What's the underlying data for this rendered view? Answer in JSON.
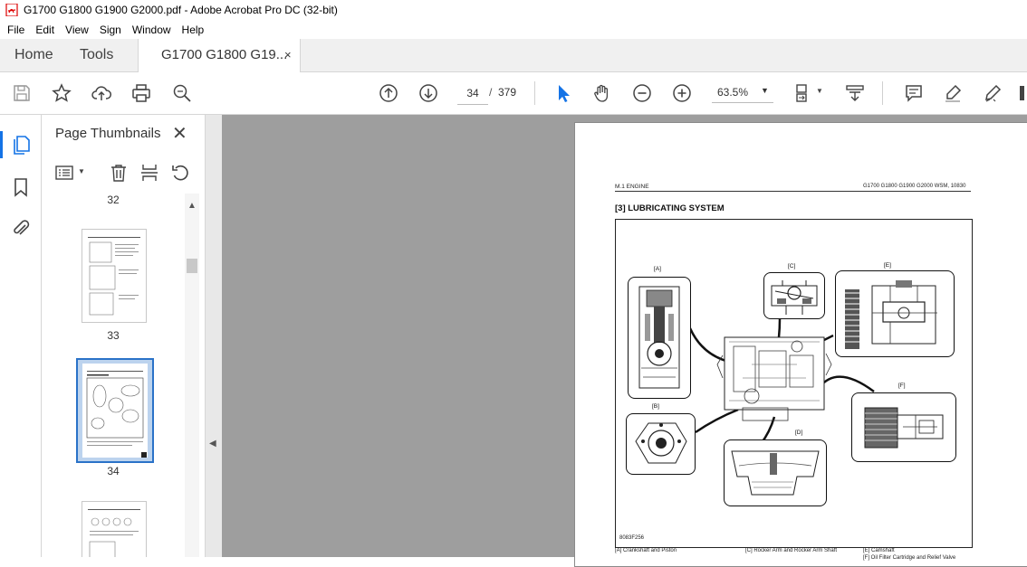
{
  "window": {
    "title": "G1700 G1800 G1900 G2000.pdf - Adobe Acrobat Pro DC (32-bit)"
  },
  "menu": [
    "File",
    "Edit",
    "View",
    "Sign",
    "Window",
    "Help"
  ],
  "tabs": {
    "home": "Home",
    "tools": "Tools",
    "document": "G1700 G1800 G19...",
    "close": "×"
  },
  "toolbar": {
    "page_current": "34",
    "page_separator": "/",
    "page_total": "379",
    "zoom": "63.5%",
    "icons": [
      "save-icon",
      "bookmark-star-icon",
      "upload-cloud-icon",
      "print-icon",
      "zoom-search-icon",
      "page-up-icon",
      "page-down-icon",
      "select-pointer-icon",
      "hand-icon",
      "zoom-out-icon",
      "zoom-in-icon",
      "page-fit-icon",
      "scroll-mode-icon",
      "comment-icon",
      "highlight-pen-icon",
      "sign-pen-icon"
    ]
  },
  "side_panel": {
    "title": "Page Thumbnails",
    "close": "✕",
    "thumbnails": [
      {
        "label": "32"
      },
      {
        "label": "33"
      },
      {
        "label": "34",
        "selected": true
      },
      {
        "label": ""
      }
    ]
  },
  "document_page": {
    "header_left": "M.1 ENGINE",
    "header_right": "G1700 G1800 G1900 G2000   WSM, 10830",
    "section_title": "[3]  LUBRICATING  SYSTEM",
    "figure_code": "8083F256",
    "callouts": [
      "[A]",
      "[B]",
      "[C]",
      "[D]",
      "[E]",
      "[F]"
    ],
    "legend": [
      "[A]   Crankshaft and Piston",
      "[C]   Rocker Arm and Rocker Arm Shaft",
      "[E]   Camshaft",
      "[F]   Oil Filter Cartridge and Relief Valve"
    ]
  },
  "colors": {
    "accent": "#1473e6",
    "doc_bg": "#9e9e9e",
    "selected_thumb": "#bcd3ee"
  }
}
